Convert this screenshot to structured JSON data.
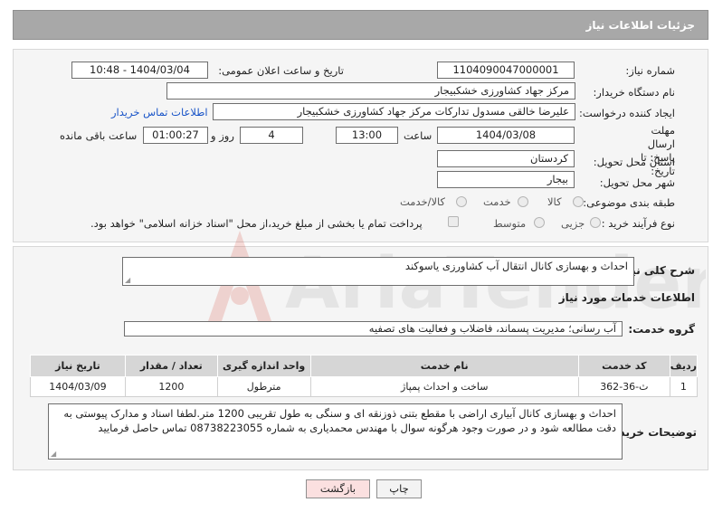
{
  "header": {
    "title": "جزئیات اطلاعات نیاز"
  },
  "fields": {
    "need_number_label": "شماره نیاز:",
    "need_number": "1104090047000001",
    "announce_label": "تاریخ و ساعت اعلان عمومی:",
    "announce_value": "1404/03/04 - 10:48",
    "buyer_label": "نام دستگاه خریدار:",
    "buyer_value": "مرکز جهاد کشاورزی خشکبیجار",
    "creator_label": "ایجاد کننده درخواست:",
    "creator_value": "علیرضا  خالقی مسدول تدارکات مرکز جهاد کشاورزی خشکبیجار",
    "contact_link": "اطلاعات تماس خریدار",
    "deadline_label": "مهلت ارسال پاسخ: تا تاریخ:",
    "deadline_date": "1404/03/08",
    "time_label": "ساعت",
    "deadline_time": "13:00",
    "days_value": "4",
    "days_label": "روز و",
    "remaining_value": "01:00:27",
    "remaining_label": "ساعت باقی مانده",
    "province_label": "استان محل تحویل:",
    "province_value": "کردستان",
    "city_label": "شهر محل تحویل:",
    "city_value": "بیجار",
    "category_label": "طبقه بندی موضوعی:",
    "category_options": [
      "کالا",
      "خدمت",
      "کالا/خدمت"
    ],
    "process_label": "نوع فرآیند خرید :",
    "process_options": [
      "جزیی",
      "متوسط"
    ],
    "payment_note": "پرداخت تمام یا بخشی از مبلغ خرید،از محل \"اسناد خزانه اسلامی\" خواهد بود."
  },
  "summary": {
    "label": "شرح کلی نیاز:",
    "value": "احداث و بهسازی کانال انتقال آب کشاورزی یاسوکند"
  },
  "services": {
    "section_title": "اطلاعات خدمات مورد نیاز",
    "group_label": "گروه خدمت:",
    "group_value": "آب رسانی؛ مدیریت پسماند، فاضلاب و فعالیت های تصفیه",
    "columns": [
      "ردیف",
      "کد خدمت",
      "نام خدمت",
      "واحد اندازه گیری",
      "تعداد / مقدار",
      "تاریخ نیاز"
    ],
    "rows": [
      [
        "1",
        "ث-36-362",
        "ساخت و احداث پمپاژ",
        "مترطول",
        "1200",
        "1404/03/09"
      ]
    ]
  },
  "notes": {
    "label": "توضیحات خریدار:",
    "value": "احداث و بهسازی کانال آبیاری اراضی با مقطع بتنی ذوزنقه ای و سنگی به طول تقریبی 1200 متر.لطفا اسناد و مدارک پیوستی به دقت مطالعه شود و در صورت وجود هرگونه سوال با مهندس محمدیاری به شماره 08738223055 تماس حاصل فرمایید"
  },
  "buttons": {
    "print": "چاپ",
    "back": "بازگشت"
  },
  "watermark": {
    "text": "AriaTender.neT"
  },
  "colors": {
    "header_bg": "#a8a8a8",
    "link": "#1a55c8",
    "back_button_bg": "#fbe0e0",
    "table_header_bg": "#d6d6d6"
  }
}
